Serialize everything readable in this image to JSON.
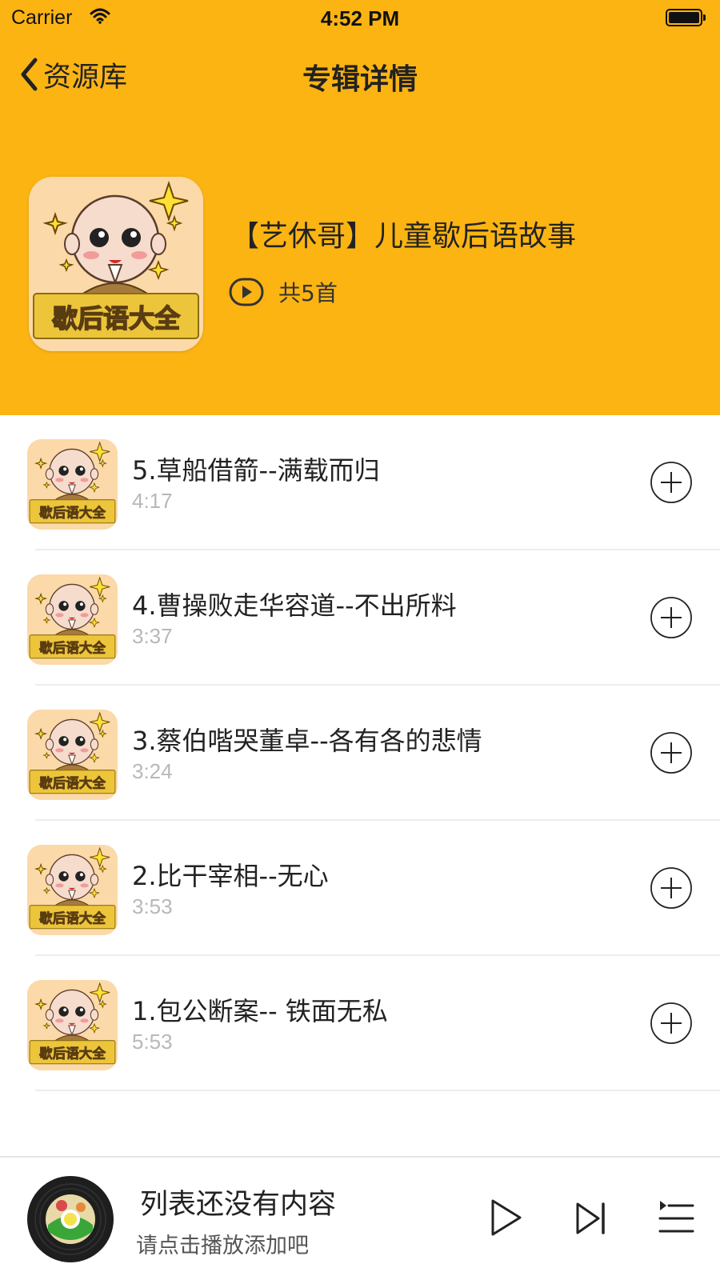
{
  "status_bar": {
    "carrier": "Carrier",
    "time": "4:52 PM"
  },
  "nav": {
    "back_label": "资源库",
    "title": "专辑详情"
  },
  "album": {
    "cover_text": "歇后语大全",
    "title": "【艺休哥】儿童歇后语故事",
    "count": "共5首"
  },
  "tracks": [
    {
      "title": "5.草船借箭--满载而归",
      "duration": "4:17"
    },
    {
      "title": "4.曹操败走华容道--不出所料",
      "duration": "3:37"
    },
    {
      "title": "3.蔡伯喈哭董卓--各有各的悲情",
      "duration": "3:24"
    },
    {
      "title": "2.比干宰相--无心",
      "duration": "3:53"
    },
    {
      "title": "1.包公断案-- 铁面无私",
      "duration": "5:53"
    }
  ],
  "player": {
    "title": "列表还没有内容",
    "subtitle": "请点击播放添加吧"
  },
  "colors": {
    "header_bg": "#fcb413",
    "divider": "#ededed",
    "duration_text": "#b8b8b8"
  },
  "icons": [
    "wifi-icon",
    "battery-icon",
    "back-chevron-icon",
    "play-circle-icon",
    "add-circle-icon",
    "vinyl-disc-icon",
    "play-icon",
    "next-track-icon",
    "playlist-icon"
  ]
}
